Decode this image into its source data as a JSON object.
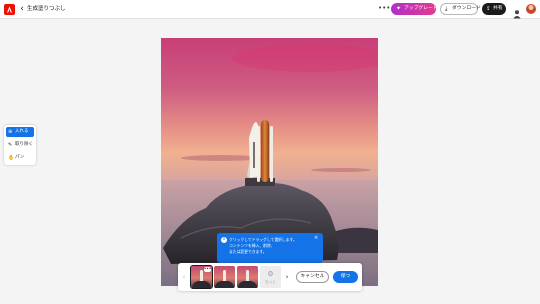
{
  "header": {
    "title": "生成塗りつぶし",
    "upgrade_label": "アップグレード",
    "download_label": "ダウンロード",
    "share_label": "共有"
  },
  "tools": {
    "items": [
      {
        "label": "入れる",
        "icon": "insert-icon",
        "active": true
      },
      {
        "label": "取り除く",
        "icon": "remove-icon",
        "active": false
      },
      {
        "label": "パン",
        "icon": "pan-icon",
        "active": false
      }
    ]
  },
  "tooltip": {
    "message": "クリックしてドラッグして選択します。\nコンテンツを挿入、削除、\nまたは変更できます。"
  },
  "variations": {
    "more_label": "もっと",
    "thumbnails": 3,
    "selected_index": 0,
    "options_badge": "•••"
  },
  "actions": {
    "cancel_label": "キャンセル",
    "keep_label": "保つ"
  },
  "colors": {
    "accent": "#1473e6",
    "brand": "#eb1000",
    "upgrade_start": "#b02fc8",
    "upgrade_end": "#e4398f"
  }
}
